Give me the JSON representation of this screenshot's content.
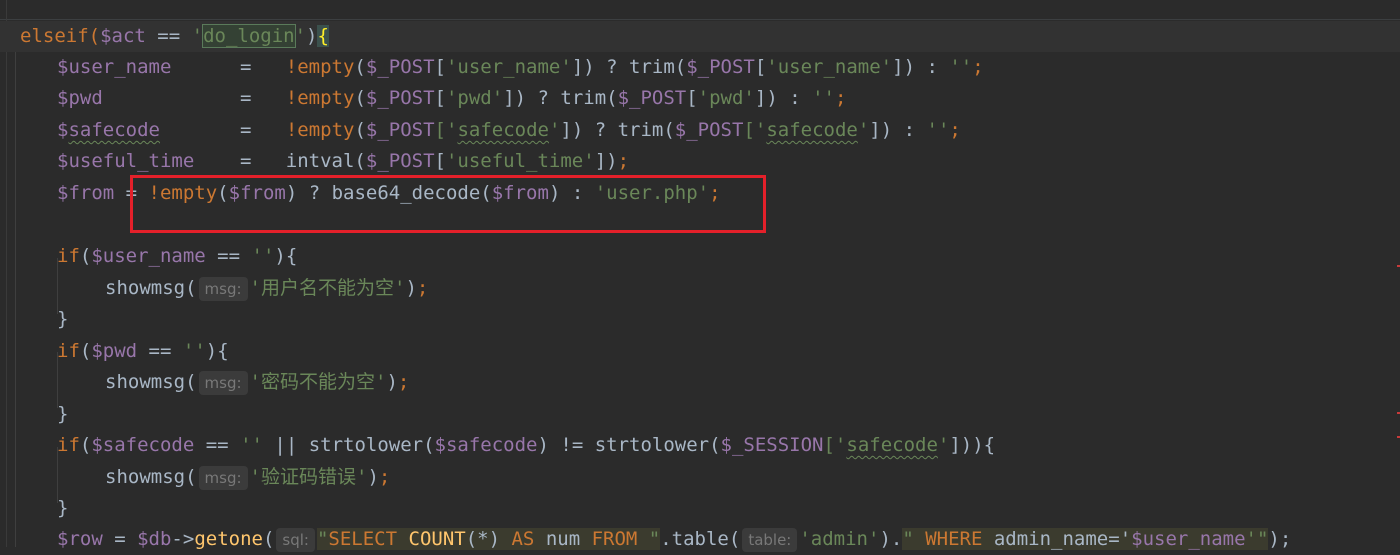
{
  "editor": {
    "theme": "Darcula",
    "colors": {
      "background": "#2b2b2b",
      "keyword": "#cc7832",
      "variable": "#9876aa",
      "string": "#6a8759",
      "highlight_box": "#e4202a"
    },
    "lines": {
      "l1": {
        "a": "elseif(",
        "b": "$act",
        "c": " == ",
        "d": "'",
        "e": "do_login",
        "f": "'",
        "g": ")",
        "h": "{"
      },
      "l2": {
        "a": "$user_name",
        "b": "      =   ",
        "c": "!empty",
        "d": "(",
        "e": "$_POST",
        "f": "[",
        "g": "'user_name'",
        "h": "]) ? trim(",
        "i": "$_POST",
        "j": "[",
        "k": "'user_name'",
        "l": "]) : ",
        "m": "''",
        "n": ";"
      },
      "l3": {
        "a": "$pwd",
        "b": "            =   ",
        "c": "!empty",
        "d": "(",
        "e": "$_POST",
        "f": "[",
        "g": "'pwd'",
        "h": "]) ? trim(",
        "i": "$_POST",
        "j": "[",
        "k": "'pwd'",
        "l": "]) : ",
        "m": "''",
        "n": ";"
      },
      "l4": {
        "a": "$",
        "a2": "safecode",
        "b": "       =   ",
        "c": "!empty",
        "d": "(",
        "e": "$_POST",
        "f": "['",
        "g": "safecode",
        "g2": "'",
        "h": "]) ? trim(",
        "i": "$_POST",
        "j": "['",
        "k": "safecode",
        "k2": "'",
        "l": "]) : ",
        "m": "''",
        "n": ";"
      },
      "l5": {
        "a": "$useful_time",
        "b": "    =   intval(",
        "e": "$_POST",
        "f": "[",
        "g": "'useful_time'",
        "h": "])",
        "n": ";"
      },
      "l6": {
        "a": "$from",
        "b": " = ",
        "c": "!empty",
        "d": "(",
        "e": "$from",
        "f": ") ? base64_decode(",
        "g": "$from",
        "h": ") : ",
        "i": "'user.php'",
        "n": ";"
      },
      "l8": {
        "a": "if",
        "b": "(",
        "c": "$user_name",
        "d": " == ",
        "e": "''",
        "f": "){"
      },
      "l9": {
        "a": "showmsg(",
        "hint": "msg:",
        "q1": "'",
        "cn": "用户名不能为空",
        "q2": "'",
        "b": ")",
        "n": ";"
      },
      "l10": {
        "a": "}"
      },
      "l11": {
        "a": "if",
        "b": "(",
        "c": "$pwd",
        "d": " == ",
        "e": "''",
        "f": "){"
      },
      "l12": {
        "a": "showmsg(",
        "hint": "msg:",
        "q1": "'",
        "cn": "密码不能为空",
        "q2": "'",
        "b": ")",
        "n": ";"
      },
      "l13": {
        "a": "}"
      },
      "l14": {
        "a": "if",
        "b": "(",
        "c": "$safecode",
        "d": " == ",
        "e": "''",
        "f": " || strtolower(",
        "g": "$safecode",
        "h": ") != strtolower(",
        "i": "$_SESSION",
        "j": "['",
        "k": "safecode",
        "k2": "'",
        "l": "])){"
      },
      "l15": {
        "a": "showmsg(",
        "hint": "msg:",
        "q1": "'",
        "cn": "验证码错误",
        "q2": "'",
        "b": ")",
        "n": ";"
      },
      "l16": {
        "a": "}"
      },
      "l17": {
        "a": "$row",
        "b": " = ",
        "c": "$db",
        "d": "->",
        "e": "getone",
        "f": "(",
        "hint1": "sql:",
        "s1": "\"",
        "s2": "SELECT",
        "s3": " ",
        "s4": "COUNT",
        "s5": "(*) ",
        "s6": "AS",
        "s7": " num ",
        "s8": "FROM",
        "s9": " \"",
        "g": ".table(",
        "hint2": "table:",
        "t": "'admin'",
        "h": ").",
        "s10": "\" ",
        "s11": "WHERE",
        "s12": " admin_name='",
        "s13": "$user_name",
        "s14": "'\"",
        "n": ");"
      }
    }
  }
}
